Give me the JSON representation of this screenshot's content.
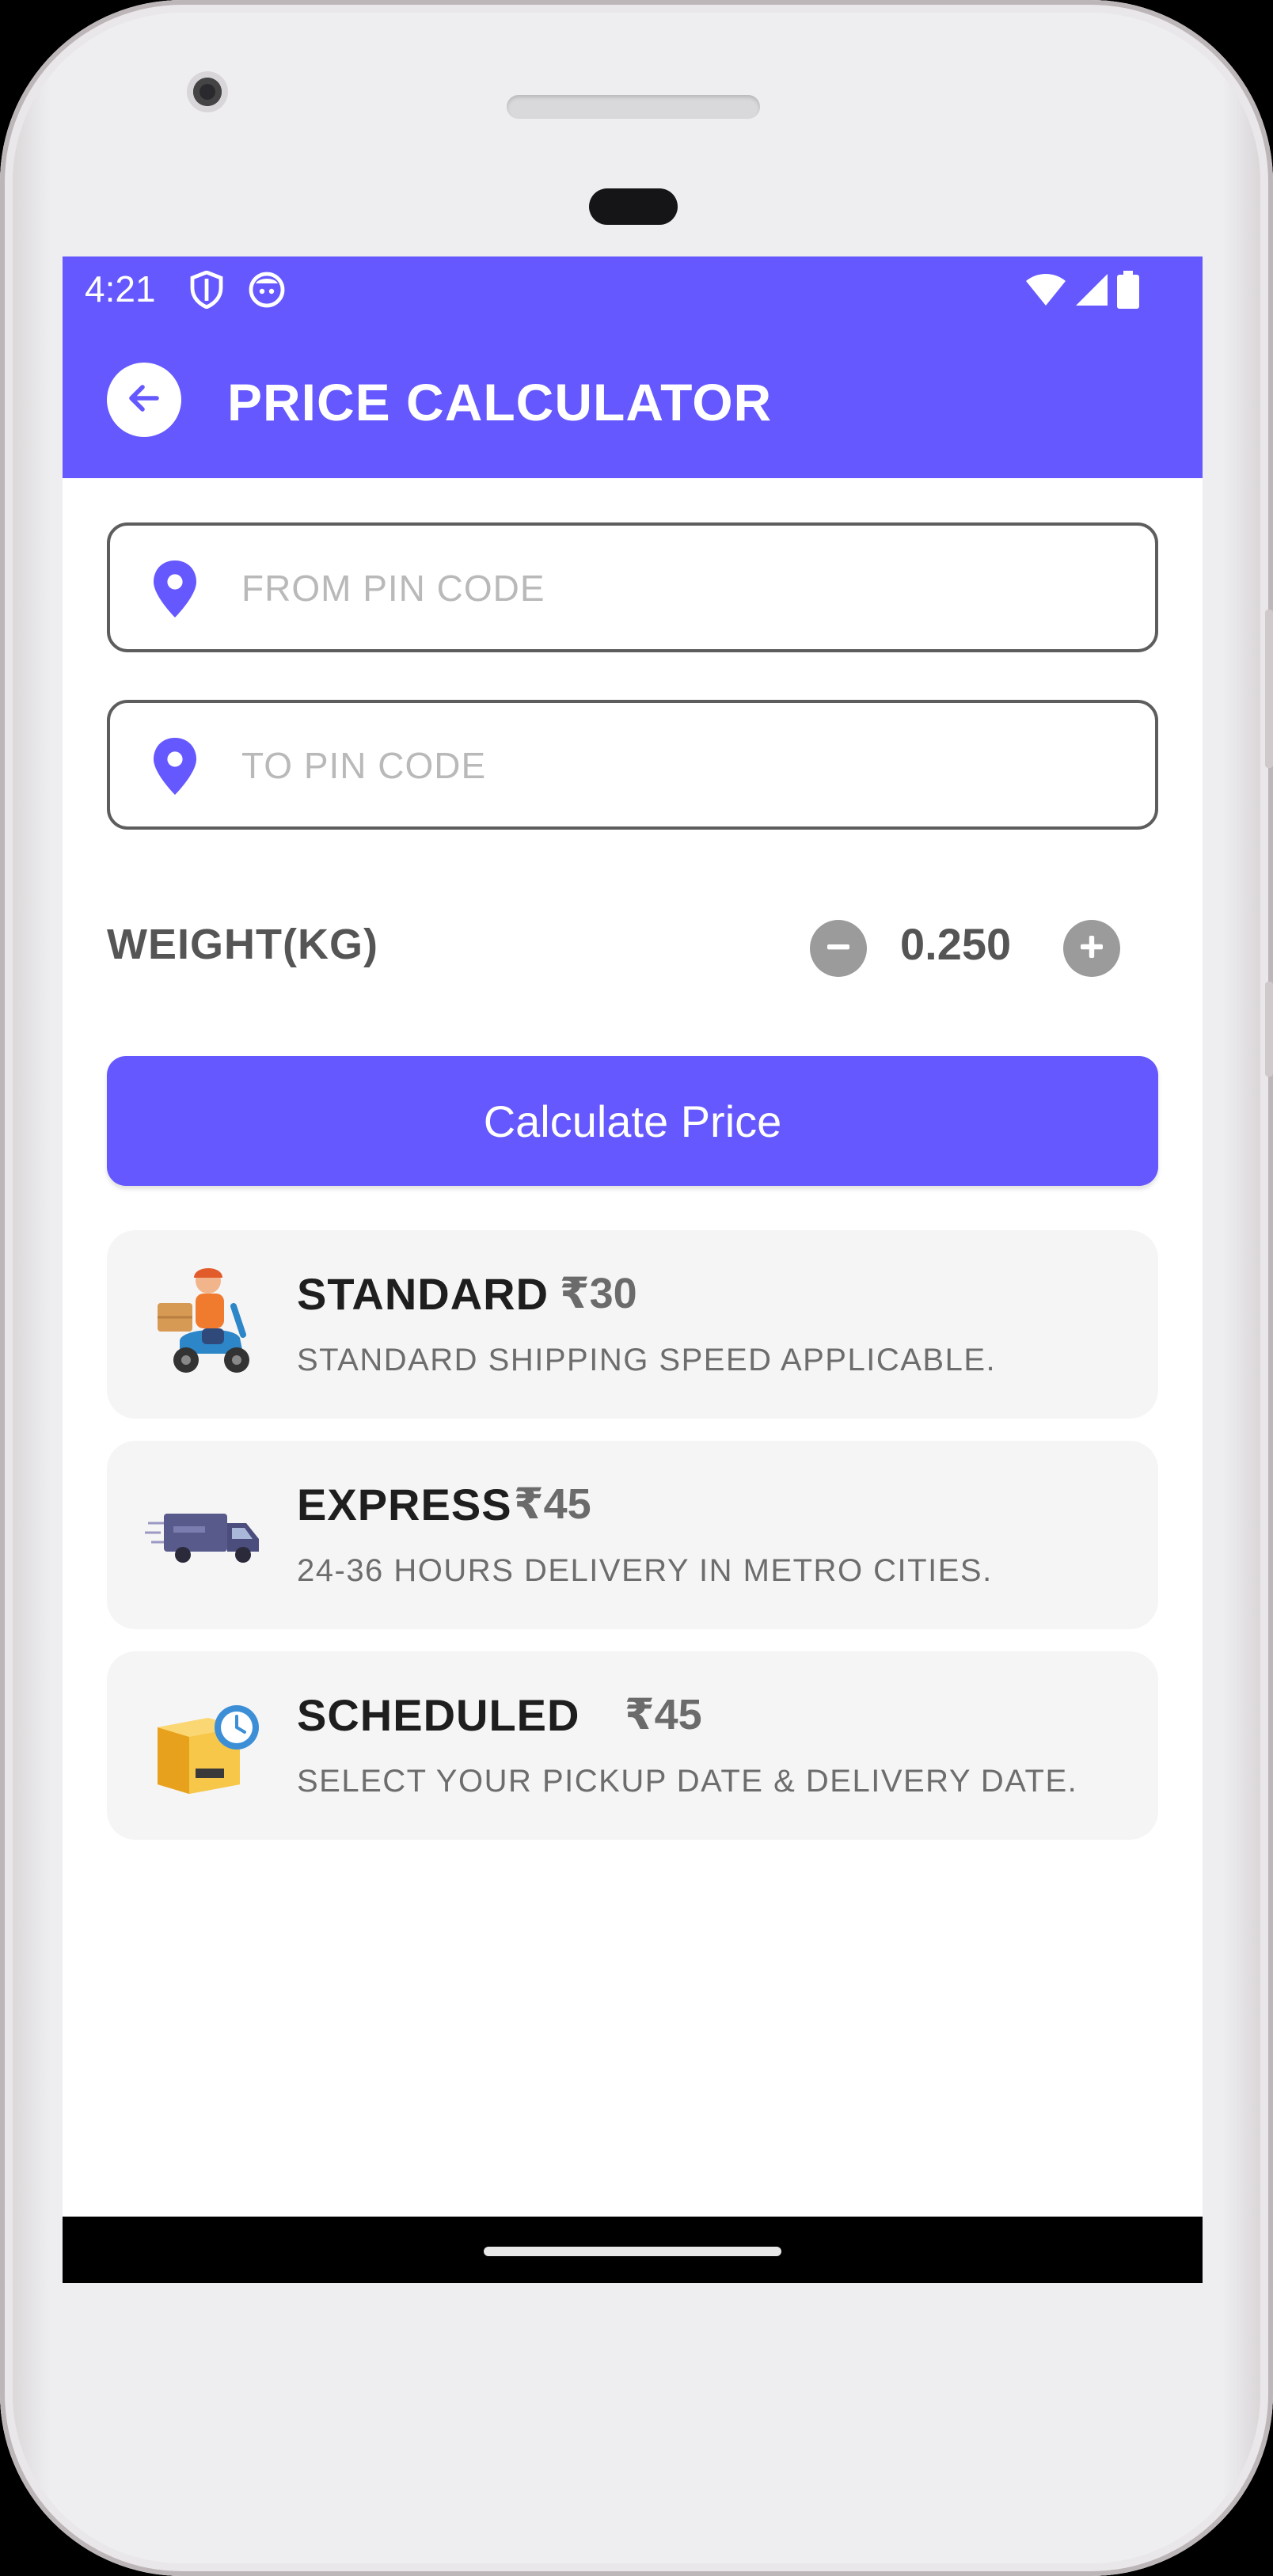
{
  "status_bar": {
    "time": "4:21",
    "left_icons": [
      "shield-icon",
      "face-icon"
    ],
    "right_icons": [
      "wifi-icon",
      "cellular-signal-icon",
      "battery-icon"
    ]
  },
  "header": {
    "title": "PRICE CALCULATOR",
    "back_icon": "arrow-left-icon",
    "accent_color": "#6558fe"
  },
  "form": {
    "from_pin": {
      "placeholder": "FROM PIN CODE",
      "value": "",
      "icon": "location-pin-icon"
    },
    "to_pin": {
      "placeholder": "TO PIN CODE",
      "value": "",
      "icon": "location-pin-icon"
    },
    "weight": {
      "label": "WEIGHT(KG)",
      "value": "0.250",
      "decrement_icon": "minus-circle-icon",
      "increment_icon": "plus-circle-icon"
    },
    "calculate_label": "Calculate Price"
  },
  "shipping_options": [
    {
      "name": "STANDARD",
      "price": "₹30",
      "description": "STANDARD SHIPPING SPEED APPLICABLE.",
      "icon": "delivery-scooter-icon"
    },
    {
      "name": "EXPRESS",
      "price": "₹45",
      "description": "24-36 HOURS DELIVERY IN METRO CITIES.",
      "icon": "delivery-van-icon"
    },
    {
      "name": "SCHEDULED",
      "price": "₹45",
      "description": "SELECT YOUR PICKUP DATE & DELIVERY DATE.",
      "icon": "scheduled-box-icon"
    }
  ]
}
